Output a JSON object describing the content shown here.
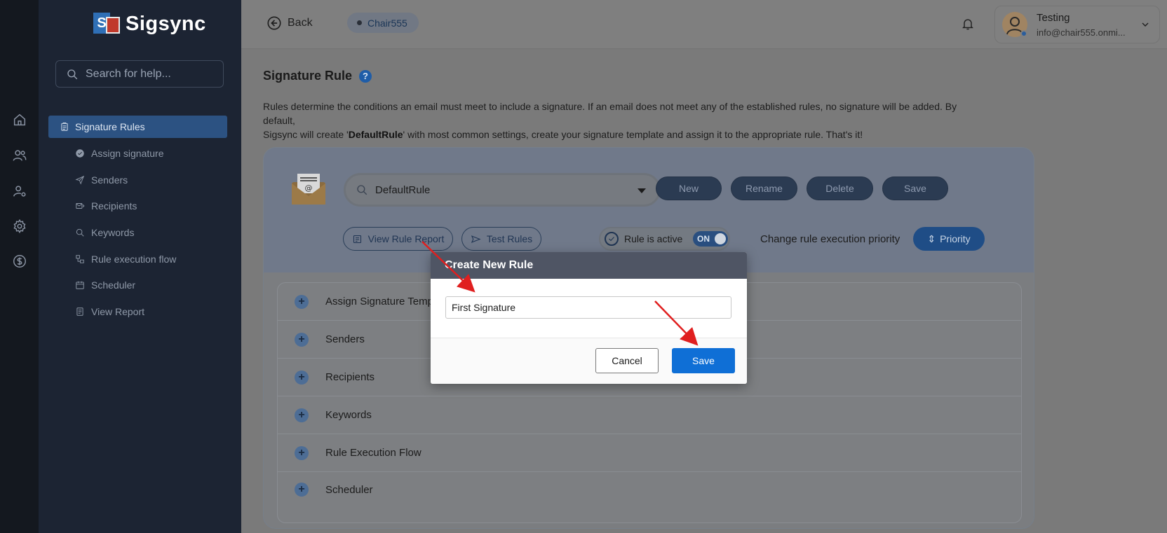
{
  "brand": {
    "name": "Sigsync"
  },
  "rail": {
    "icons": [
      "home-icon",
      "users-icon",
      "user-settings-icon",
      "gear-icon",
      "dollar-icon"
    ]
  },
  "sidebar": {
    "search_placeholder": "Search for help...",
    "active_item": "Signature Rules",
    "items": [
      {
        "label": "Assign signature",
        "icon": "check-circle-icon"
      },
      {
        "label": "Senders",
        "icon": "send-icon"
      },
      {
        "label": "Recipients",
        "icon": "recipients-icon"
      },
      {
        "label": "Keywords",
        "icon": "search-icon"
      },
      {
        "label": "Rule execution flow",
        "icon": "flow-icon"
      },
      {
        "label": "Scheduler",
        "icon": "calendar-icon"
      },
      {
        "label": "View Report",
        "icon": "report-icon"
      }
    ]
  },
  "header": {
    "back_label": "Back",
    "tenant_chip": "Chair555",
    "user_name": "Testing",
    "user_email": "info@chair555.onmi..."
  },
  "page": {
    "title": "Signature Rule",
    "desc_part1": "Rules determine the conditions an email must meet to include a signature. If an email does not meet any of the established rules, no signature will be added. By default,",
    "desc_part2a": "Sigsync will create '",
    "desc_bold": "DefaultRule",
    "desc_part2b": "' with most common settings, create your signature template and assign it to the appropriate rule. That's it!"
  },
  "rule_panel": {
    "selected_rule": "DefaultRule",
    "buttons": {
      "new": "New",
      "rename": "Rename",
      "delete": "Delete",
      "save": "Save"
    },
    "view_report": "View Rule Report",
    "test_rules": "Test Rules",
    "rule_active_label": "Rule is active",
    "toggle_state": "ON",
    "priority_text": "Change rule execution priority",
    "priority_button": "Priority"
  },
  "accordion": [
    "Assign Signature Template",
    "Senders",
    "Recipients",
    "Keywords",
    "Rule Execution Flow",
    "Scheduler"
  ],
  "modal": {
    "title": "Create New Rule",
    "input_value": "First Signature",
    "cancel": "Cancel",
    "save": "Save"
  },
  "colors": {
    "accent": "#0f6fd6",
    "sidebar_active": "#2c5282",
    "annotation_arrow": "#e01f1f"
  }
}
